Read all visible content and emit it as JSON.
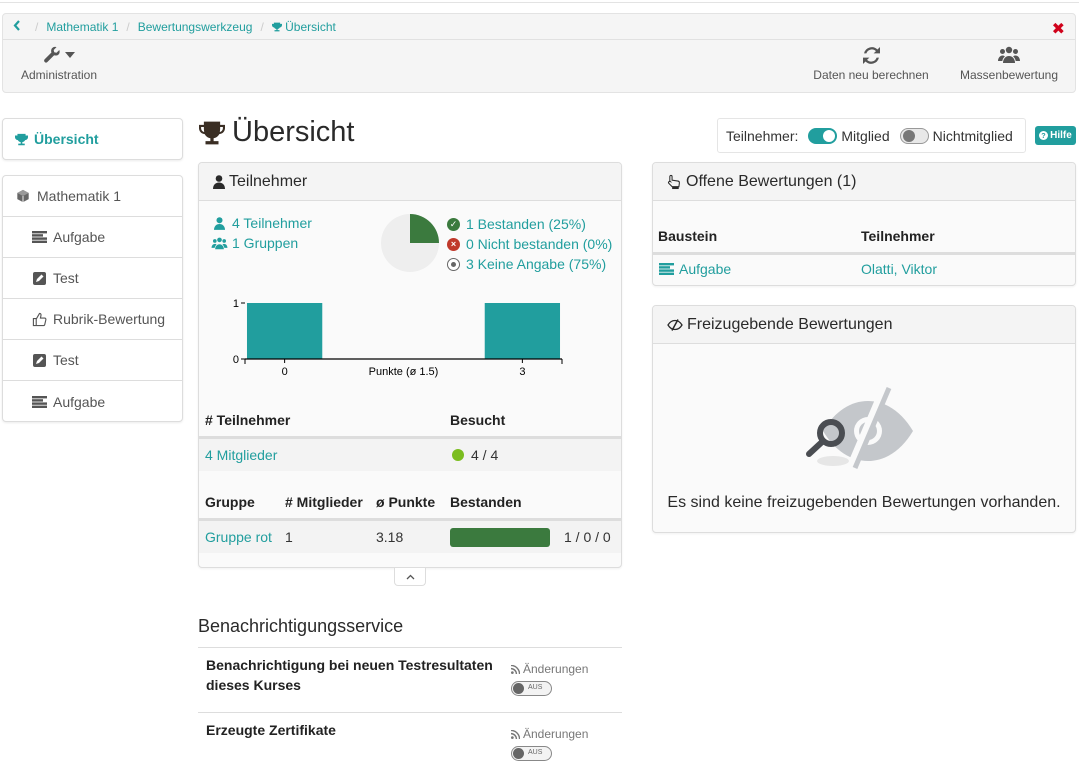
{
  "breadcrumb": {
    "back_label": "‹",
    "items": [
      "Mathematik 1",
      "Bewertungswerkzeug"
    ],
    "current": "Übersicht"
  },
  "toolbar": {
    "administration": "Administration",
    "recalculate": "Daten neu berechnen",
    "mass_grading": "Massenbewertung"
  },
  "sidebar": {
    "active": "Übersicht",
    "tree": [
      {
        "label": "Mathematik 1",
        "icon": "cube-icon",
        "level": 0
      },
      {
        "label": "Aufgabe",
        "icon": "task-icon",
        "level": 1
      },
      {
        "label": "Test",
        "icon": "test-edit-icon",
        "level": 1
      },
      {
        "label": "Rubrik-Bewertung",
        "icon": "thumbs-up-icon",
        "level": 1
      },
      {
        "label": "Test",
        "icon": "test-edit-icon",
        "level": 1
      },
      {
        "label": "Aufgabe",
        "icon": "task-icon",
        "level": 1
      }
    ]
  },
  "page": {
    "title": "Übersicht"
  },
  "filter": {
    "label": "Teilnehmer:",
    "member": {
      "label": "Mitglied",
      "on": true
    },
    "non_member": {
      "label": "Nichtmitglied",
      "on": false
    },
    "help": "Hilfe"
  },
  "participants_panel": {
    "title": "Teilnehmer",
    "participants_link": "4 Teilnehmer",
    "groups_link": "1 Gruppen",
    "passed": "1 Bestanden (25%)",
    "failed": "0 Nicht bestanden (0%)",
    "undefined": "3 Keine Angabe (75%)",
    "members_table": {
      "headers": [
        "# Teilnehmer",
        "Besucht"
      ],
      "row": {
        "members": "4 Mitglieder",
        "visited": "4 / 4"
      }
    },
    "groups_table": {
      "headers": [
        "Gruppe",
        "# Mitglieder",
        "ø Punkte",
        "Bestanden"
      ],
      "rows": [
        {
          "group": "Gruppe rot",
          "members": "1",
          "avg_points": "3.18",
          "passed_fraction": 1.0,
          "passed_counts": "1 / 0 / 0"
        }
      ]
    }
  },
  "colors": {
    "accent": "#219e9e",
    "passed": "#3b7a3e",
    "failed": "#c0392b",
    "neutral": "#777777",
    "visited": "#7bbd1f",
    "close": "#d0021b"
  },
  "chart_data": [
    {
      "type": "pie",
      "title": "",
      "categories": [
        "Bestanden",
        "Nicht bestanden",
        "Keine Angabe"
      ],
      "values": [
        1,
        0,
        3
      ],
      "percentages": [
        25,
        0,
        75
      ],
      "colors": [
        "#3b7a3e",
        "#c0392b",
        "#eeeeee"
      ]
    },
    {
      "type": "bar",
      "title": "",
      "categories": [
        "0",
        "3"
      ],
      "x": [
        0,
        3
      ],
      "values": [
        1,
        1
      ],
      "xlabel": "Punkte (ø 1.5)",
      "ylabel": "",
      "ylim": [
        0,
        1
      ],
      "xlim": [
        -0.5,
        3.5
      ],
      "yticks": [
        "0",
        "1"
      ],
      "xticks": [
        "0",
        "3"
      ],
      "color": "#219e9e",
      "grid": false
    }
  ],
  "open_assessments": {
    "title": "Offene Bewertungen (1)",
    "headers": [
      "Baustein",
      "Teilnehmer"
    ],
    "rows": [
      {
        "element": "Aufgabe",
        "participant": "Olatti, Viktor"
      }
    ]
  },
  "release_assessments": {
    "title": "Freizugebende Bewertungen",
    "empty_message": "Es sind keine freizugebenden Bewertungen vorhanden."
  },
  "notifications": {
    "title": "Benachrichtigungsservice",
    "items": [
      {
        "label": "Benachrichtigung bei neuen Testresultaten dieses Kurses",
        "changes": "Änderungen",
        "toggle": "AUS",
        "on": false
      },
      {
        "label": "Erzeugte Zertifikate",
        "changes": "Änderungen",
        "toggle": "AUS",
        "on": false
      }
    ]
  }
}
